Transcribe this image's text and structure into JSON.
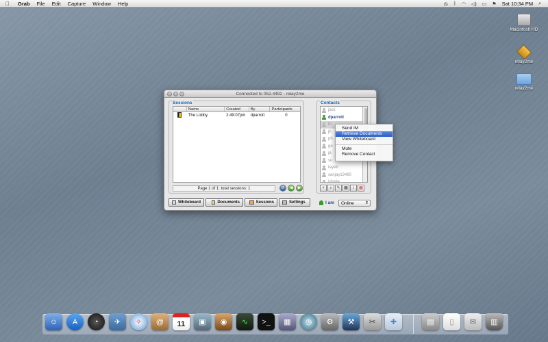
{
  "menubar": {
    "app": "Grab",
    "items": [
      "File",
      "Edit",
      "Capture",
      "Window",
      "Help"
    ],
    "clock": "Sat 10:34 PM"
  },
  "desktop_icons": [
    "Macintosh HD",
    "relay2me",
    "relay2me"
  ],
  "window": {
    "title": "Connected to 052.4492 - relay2me",
    "sessions": {
      "label": "Sessions",
      "columns": [
        "",
        "Name",
        "Created",
        "By",
        "Participants"
      ],
      "rows": [
        {
          "name": "The Lobby",
          "created": "2:49:07pm",
          "by": "dparrott",
          "participants": "0"
        }
      ],
      "pager": "Page 1 of 1: total sessions: 1"
    },
    "contacts": {
      "label": "Contacts",
      "items": [
        "jack",
        "dparrott",
        "br",
        "jh",
        "ph",
        "go",
        "ja",
        "su",
        "tayeb",
        "sanjay13480",
        "ishwie"
      ]
    },
    "buttons": {
      "whiteboard": "Whiteboard",
      "documents": "Documents",
      "sessions": "Sessions",
      "settings": "Settings"
    },
    "iam_label": "I am",
    "status": "Online"
  },
  "context_menu": {
    "items": [
      "Send IM",
      "Retrieve Documents",
      "View Whiteboard",
      "Mute",
      "Remove Contact"
    ],
    "highlighted": "Retrieve Documents"
  },
  "colors": {
    "accent": "#2a5fc6",
    "group_label": "#1d5fb7",
    "online": "#3a9a2a"
  }
}
